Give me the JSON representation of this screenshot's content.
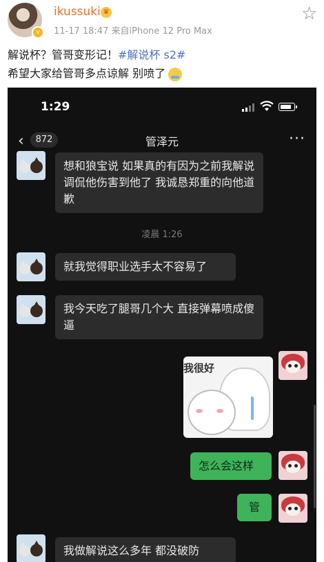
{
  "post": {
    "username": "ikussuki",
    "time": "11-17 18:47",
    "source": "来自iPhone 12 Pro Max",
    "line1_text": "解说杯？管哥变形记！",
    "hashtag": "#解说杯 s2#",
    "line2_text": "希望大家给管哥多点谅解 别喷了"
  },
  "phone": {
    "status_time": "1:29",
    "unread_count": "872",
    "chat_title": "管泽元",
    "more": "···"
  },
  "messages": {
    "m1": "想和狼宝说 如果真的有因为之前我解说调侃他伤害到他了 我诚恳郑重的向他道歉",
    "timestamp": "凌晨 1:26",
    "m2": "就我觉得职业选手太不容易了",
    "m3": "我今天吃了腿哥几个大 直接弹幕喷成傻逼",
    "sticker_text": "我很好",
    "m4": "怎么会这样",
    "m5": "管",
    "m6": "我做解说这么多年 都没破防"
  },
  "colors": {
    "username": "#e8702a",
    "hashtag": "#4f73c2",
    "chat_bg": "#111111",
    "bubble_in": "#2c2c2c",
    "bubble_out": "#3fb35a"
  },
  "icons": [
    "crown-icon",
    "star-icon",
    "crying-emoji",
    "signal-icon",
    "wifi-icon",
    "battery-icon",
    "back-icon",
    "more-icon"
  ]
}
